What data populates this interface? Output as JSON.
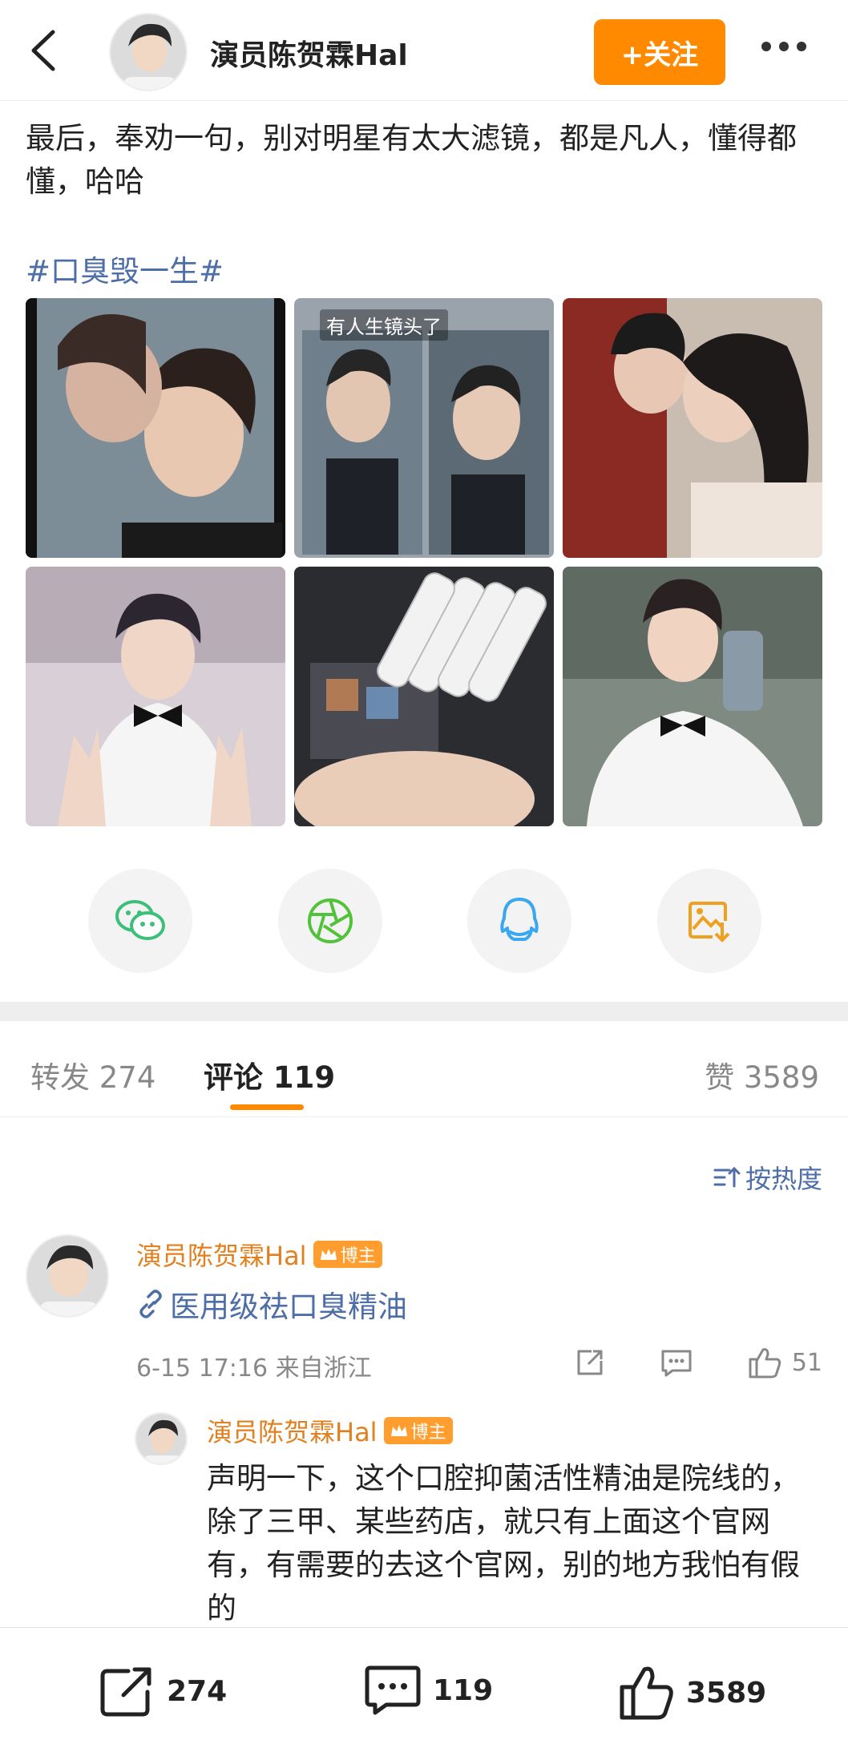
{
  "header": {
    "username": "演员陈贺霖Hal",
    "follow_label": "+关注"
  },
  "post": {
    "text": "最后，奉劝一句，别对明星有太大滤镜，都是凡人，懂得都懂，哈哈",
    "hashtag": "#口臭毁一生#",
    "image2_caption": "有人生镜头了"
  },
  "share": {
    "icons": [
      "wechat-icon",
      "moments-icon",
      "qq-icon",
      "save-image-icon"
    ]
  },
  "tabs": {
    "repost": "转发 274",
    "comment": "评论 119",
    "like": "赞 3589"
  },
  "sort_label": "按热度",
  "comment": {
    "author": "演员陈贺霖Hal",
    "badge": "博主",
    "link_text": "医用级祛口臭精油",
    "meta": "6-15 17:16 来自浙江",
    "like_count": "51"
  },
  "reply": {
    "author": "演员陈贺霖Hal",
    "badge": "博主",
    "text": "声明一下，这个口腔抑菌活性精油是院线的，除了三甲、某些药店，就只有上面这个官网有，有需要的去这个官网，别的地方我怕有假的"
  },
  "bottom_bar": {
    "repost_count": "274",
    "comment_count": "119",
    "like_count": "3589"
  },
  "colors": {
    "accent": "#ff8a00",
    "link": "#4e6ea7",
    "author": "#e2801f"
  }
}
